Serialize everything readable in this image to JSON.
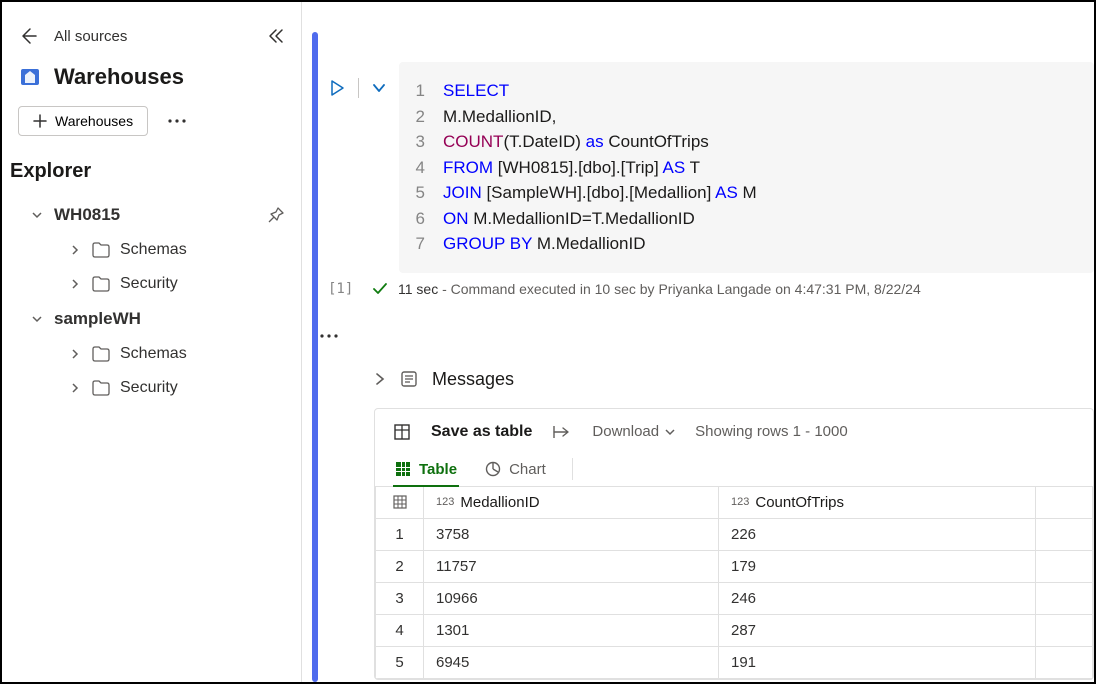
{
  "sidebar": {
    "all_sources": "All sources",
    "section_title": "Warehouses",
    "chip_label": "Warehouses",
    "explorer_label": "Explorer",
    "tree": [
      {
        "name": "WH0815",
        "children": [
          "Schemas",
          "Security"
        ]
      },
      {
        "name": "sampleWH",
        "children": [
          "Schemas",
          "Security"
        ]
      }
    ]
  },
  "editor": {
    "lines": [
      {
        "n": "1",
        "tokens": [
          {
            "t": "SELECT",
            "c": "kw"
          }
        ]
      },
      {
        "n": "2",
        "tokens": [
          {
            "t": "M.MedallionID,",
            "c": "id"
          }
        ]
      },
      {
        "n": "3",
        "tokens": [
          {
            "t": "COUNT",
            "c": "fn"
          },
          {
            "t": "(T.DateID) ",
            "c": "id"
          },
          {
            "t": "as",
            "c": "aliaskw"
          },
          {
            "t": " CountOfTrips",
            "c": "id"
          }
        ]
      },
      {
        "n": "4",
        "tokens": [
          {
            "t": "FROM",
            "c": "kw"
          },
          {
            "t": " [WH0815].[dbo].[Trip] ",
            "c": "id"
          },
          {
            "t": "AS",
            "c": "kw"
          },
          {
            "t": " T",
            "c": "id"
          }
        ]
      },
      {
        "n": "5",
        "tokens": [
          {
            "t": "JOIN",
            "c": "kw"
          },
          {
            "t": " [SampleWH].[dbo].[Medallion] ",
            "c": "id"
          },
          {
            "t": "AS",
            "c": "kw"
          },
          {
            "t": " M",
            "c": "id"
          }
        ]
      },
      {
        "n": "6",
        "tokens": [
          {
            "t": "ON",
            "c": "kw"
          },
          {
            "t": " M.MedallionID=T.MedallionID",
            "c": "id"
          }
        ]
      },
      {
        "n": "7",
        "tokens": [
          {
            "t": "GROUP BY",
            "c": "kw"
          },
          {
            "t": " M.MedallionID",
            "c": "id"
          }
        ]
      }
    ],
    "status_index": "[1]",
    "status_time": "11 sec",
    "status_rest": " - Command executed in 10 sec by Priyanka Langade on 4:47:31 PM, 8/22/24"
  },
  "results": {
    "messages_label": "Messages",
    "save_label": "Save as table",
    "download_label": "Download",
    "showing_label": "Showing rows 1 - 1000",
    "tabs": {
      "table": "Table",
      "chart": "Chart"
    },
    "columns": [
      {
        "type": "123",
        "name": "MedallionID"
      },
      {
        "type": "123",
        "name": "CountOfTrips"
      }
    ],
    "rows": [
      {
        "n": "1",
        "cells": [
          "3758",
          "226"
        ]
      },
      {
        "n": "2",
        "cells": [
          "11757",
          "179"
        ]
      },
      {
        "n": "3",
        "cells": [
          "10966",
          "246"
        ]
      },
      {
        "n": "4",
        "cells": [
          "1301",
          "287"
        ]
      },
      {
        "n": "5",
        "cells": [
          "6945",
          "191"
        ]
      }
    ]
  }
}
